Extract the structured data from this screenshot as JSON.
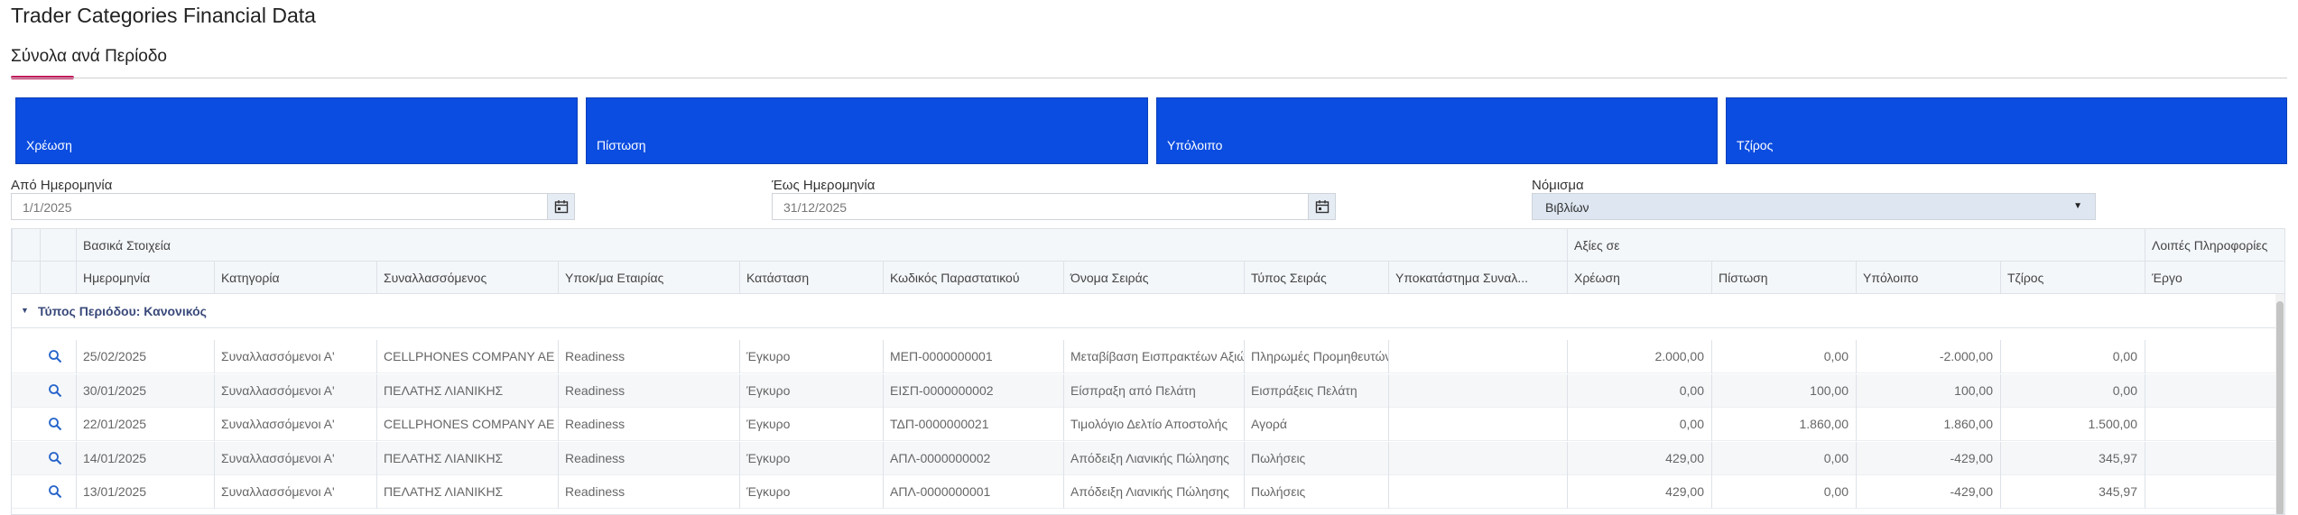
{
  "page": {
    "title": "Trader Categories Financial Data"
  },
  "tabs": [
    {
      "label": "Σύνολα ανά Περίοδο"
    }
  ],
  "cards": [
    {
      "label": "Χρέωση"
    },
    {
      "label": "Πίστωση"
    },
    {
      "label": "Υπόλοιπο"
    },
    {
      "label": "Τζίρος"
    }
  ],
  "filters": {
    "from_label": "Από Ημερομηνία",
    "from_value": "1/1/2025",
    "to_label": "Έως Ημερομηνία",
    "to_value": "31/12/2025",
    "currency_label": "Νόμισμα",
    "currency_value": "Βιβλίων"
  },
  "colors": {
    "card_bg": "#0b4de0",
    "accent": "#c2185b",
    "group_text": "#3a4a7a"
  },
  "grid": {
    "bands": {
      "basic": "Βασικά Στοιχεία",
      "values": "Αξίες σε",
      "other": "Λοιπές Πληροφορίες"
    },
    "columns": [
      "Ημερομηνία",
      "Κατηγορία",
      "Συναλλασσόμενος",
      "Υποκ/μα Εταιρίας",
      "Κατάσταση",
      "Κωδικός Παραστατικού",
      "Όνομα Σειράς",
      "Τύπος Σειράς",
      "Υποκατάστημα Συναλ...",
      "Χρέωση",
      "Πίστωση",
      "Υπόλοιπο",
      "Τζίρος",
      "Έργο"
    ],
    "group_label": "Τύπος Περιόδου: Κανονικός",
    "rows": [
      {
        "date": "25/02/2025",
        "category": "Συναλλασσόμενοι Α'",
        "trader": "CELLPHONES COMPANY AE",
        "branch": "Readiness",
        "status": "Έγκυρο",
        "code": "ΜΕΠ-0000000001",
        "series": "Μεταβίβαση Εισπρακτέων Αξιών",
        "series_type": "Πληρωμές Προμηθευτών",
        "trader_branch": "",
        "debit": "2.000,00",
        "credit": "0,00",
        "balance": "-2.000,00",
        "turnover": "0,00",
        "project": ""
      },
      {
        "date": "30/01/2025",
        "category": "Συναλλασσόμενοι Α'",
        "trader": "ΠΕΛΑΤΗΣ ΛΙΑΝΙΚΗΣ",
        "branch": "Readiness",
        "status": "Έγκυρο",
        "code": "ΕΙΣΠ-0000000002",
        "series": "Είσπραξη από Πελάτη",
        "series_type": "Εισπράξεις Πελάτη",
        "trader_branch": "",
        "debit": "0,00",
        "credit": "100,00",
        "balance": "100,00",
        "turnover": "0,00",
        "project": ""
      },
      {
        "date": "22/01/2025",
        "category": "Συναλλασσόμενοι Α'",
        "trader": "CELLPHONES COMPANY AE",
        "branch": "Readiness",
        "status": "Έγκυρο",
        "code": "ΤΔΠ-0000000021",
        "series": "Τιμολόγιο Δελτίο Αποστολής",
        "series_type": "Αγορά",
        "trader_branch": "",
        "debit": "0,00",
        "credit": "1.860,00",
        "balance": "1.860,00",
        "turnover": "1.500,00",
        "project": ""
      },
      {
        "date": "14/01/2025",
        "category": "Συναλλασσόμενοι Α'",
        "trader": "ΠΕΛΑΤΗΣ ΛΙΑΝΙΚΗΣ",
        "branch": "Readiness",
        "status": "Έγκυρο",
        "code": "ΑΠΛ-0000000002",
        "series": "Απόδειξη Λιανικής Πώλησης",
        "series_type": "Πωλήσεις",
        "trader_branch": "",
        "debit": "429,00",
        "credit": "0,00",
        "balance": "-429,00",
        "turnover": "345,97",
        "project": ""
      },
      {
        "date": "13/01/2025",
        "category": "Συναλλασσόμενοι Α'",
        "trader": "ΠΕΛΑΤΗΣ ΛΙΑΝΙΚΗΣ",
        "branch": "Readiness",
        "status": "Έγκυρο",
        "code": "ΑΠΛ-0000000001",
        "series": "Απόδειξη Λιανικής Πώλησης",
        "series_type": "Πωλήσεις",
        "trader_branch": "",
        "debit": "429,00",
        "credit": "0,00",
        "balance": "-429,00",
        "turnover": "345,97",
        "project": ""
      }
    ]
  }
}
